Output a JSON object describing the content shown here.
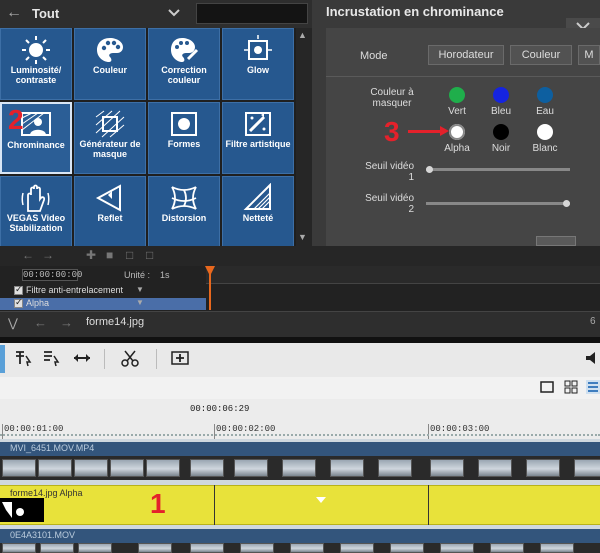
{
  "effects_panel": {
    "category": "Tout",
    "tiles": [
      {
        "label": "Luminosité/ contraste",
        "icon": "sun-icon"
      },
      {
        "label": "Couleur",
        "icon": "palette-icon"
      },
      {
        "label": "Correction couleur",
        "icon": "color-correction-icon"
      },
      {
        "label": "Glow",
        "icon": "glow-icon"
      },
      {
        "label": "Chrominance",
        "icon": "chroma-key-icon",
        "selected": true
      },
      {
        "label": "Générateur de masque",
        "icon": "mask-generator-icon"
      },
      {
        "label": "Formes",
        "icon": "shapes-icon"
      },
      {
        "label": "Filtre artistique",
        "icon": "artistic-filter-icon"
      },
      {
        "label": "VEGAS Video Stabilization",
        "icon": "stabilization-icon"
      },
      {
        "label": "Reflet",
        "icon": "reflection-icon"
      },
      {
        "label": "Distorsion",
        "icon": "distortion-icon"
      },
      {
        "label": "Netteté",
        "icon": "sharpness-icon"
      }
    ]
  },
  "chroma_panel": {
    "title": "Incrustation en chrominance",
    "mode_label": "Mode",
    "mode_buttons": [
      "Horodateur",
      "Couleur",
      "M"
    ],
    "color_mask_label": "Couleur à masquer",
    "swatches": [
      {
        "label": "Vert",
        "color": "#1fae4b"
      },
      {
        "label": "Bleu",
        "color": "#1524e0"
      },
      {
        "label": "Eau",
        "color": "#0d5fa0"
      },
      {
        "label": "Alpha",
        "color": "#ffffff",
        "selected": true
      },
      {
        "label": "Noir",
        "color": "#000000"
      },
      {
        "label": "Blanc",
        "color": "#ffffff"
      }
    ],
    "seuil1_label": "Seuil vidéo 1",
    "seuil1_value": 0.0,
    "seuil2_label": "Seuil vidéo 2",
    "seuil2_value": 1.0
  },
  "keyframes": {
    "time": "00:00:00:00",
    "unit_label": "Unité :",
    "unit_value": "1s",
    "rows": [
      {
        "label": "Filtre anti-entrelacement"
      },
      {
        "label": "Alpha"
      }
    ]
  },
  "file_bar": {
    "file_name": "forme14.jpg",
    "right_text": "6"
  },
  "timeline": {
    "current_time": "00:00:06:29",
    "ticks": [
      "00:00:01:00",
      "00:00:02:00",
      "00:00:03:00"
    ],
    "tracks": [
      {
        "name": "MVI_6451.MOV.MP4"
      },
      {
        "name": "forme14.jpg Alpha"
      },
      {
        "name": "0E4A3101.MOV"
      }
    ]
  },
  "annotations": {
    "n1": "1",
    "n2": "2",
    "n3": "3",
    "color": "#e4212b"
  }
}
